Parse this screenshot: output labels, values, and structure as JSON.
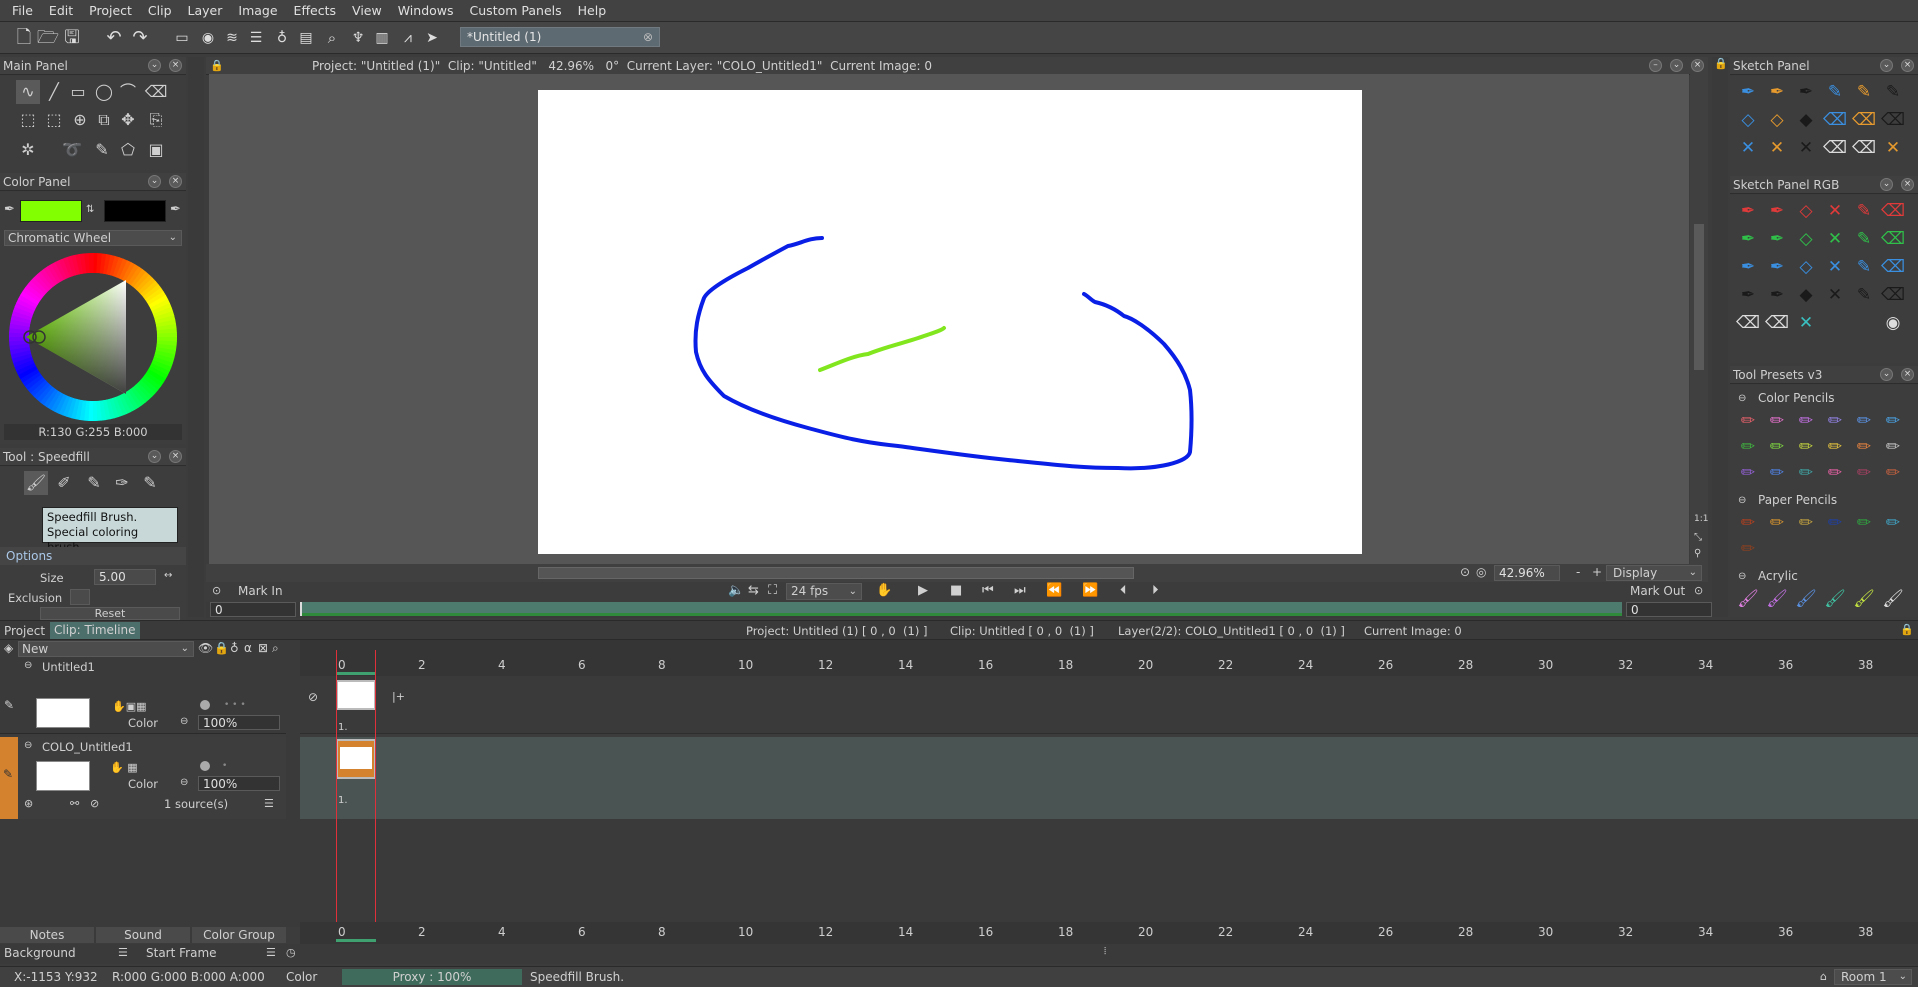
{
  "menu": [
    "File",
    "Edit",
    "Project",
    "Clip",
    "Layer",
    "Image",
    "Effects",
    "View",
    "Windows",
    "Custom Panels",
    "Help"
  ],
  "doc_tab": "*Untitled (1)",
  "viewer_info": "Project: \"Untitled (1)\"  Clip: \"Untitled\"   42.96%   0°  Current Layer: \"COLO_Untitled1\"  Current Image: 0",
  "panels": {
    "main": "Main Panel",
    "color": "Color Panel",
    "chromatic": "Chromatic Wheel",
    "rgb": "R:130 G:255 B:000",
    "tool": "Tool : Speedfill",
    "tooltip_line1": "Speedfill Brush.",
    "tooltip_line2": "Special coloring brush",
    "options": "Options",
    "size_label": "Size",
    "size_value": "5.00",
    "exclusion_label": "Exclusion",
    "reset": "Reset",
    "sketch": "Sketch Panel",
    "sketch_rgb": "Sketch Panel RGB",
    "presets": "Tool Presets v3",
    "color_pencils": "Color Pencils",
    "paper_pencils": "Paper Pencils",
    "acrylic": "Acrylic"
  },
  "colors": {
    "primary": "#82ff00",
    "secondary": "#000000",
    "stroke_blue": "#0a1fe6",
    "stroke_green": "#82e61e",
    "accent_orange": "#d4822e",
    "playhead": "#e0303a"
  },
  "viewer_bottom": {
    "zoom": "42.96%",
    "minus": "-",
    "plus": "+",
    "display": "Display"
  },
  "transport": {
    "mark_in": "Mark In",
    "mark_out": "Mark Out",
    "fps": "24 fps",
    "in_value": "0",
    "out_value": "0"
  },
  "timeline": {
    "tab_project": "Project",
    "tab_clip": "Clip: Timeline",
    "info_project": "Project: Untitled (1) [ 0 , 0  (1) ]",
    "info_clip": "Clip: Untitled [ 0 , 0  (1) ]",
    "info_layer": "Layer(2/2): COLO_Untitled1 [ 0 , 0  (1) ]",
    "info_image": "Current Image: 0",
    "new_label": "New",
    "ruler": [
      "0",
      "2",
      "4",
      "6",
      "8",
      "10",
      "12",
      "14",
      "16",
      "18",
      "20",
      "22",
      "24",
      "26",
      "28",
      "30",
      "32",
      "34",
      "36",
      "38"
    ],
    "layers": [
      {
        "name": "Untitled1",
        "mode": "Color",
        "opacity": "100%",
        "frame_label": "1."
      },
      {
        "name": "COLO_Untitled1",
        "mode": "Color",
        "opacity": "100%",
        "sources": "1 source(s)",
        "frame_label": "1."
      }
    ],
    "bottom_tabs": [
      "Notes",
      "Sound",
      "Color Group"
    ],
    "background": "Background",
    "start_frame": "Start Frame"
  },
  "status": {
    "coords": "X:-1153  Y:932",
    "rgba": "R:000 G:000 B:000 A:000",
    "mode": "Color",
    "proxy": "Proxy : 100%",
    "message": "Speedfill Brush.",
    "room": "Room 1"
  }
}
